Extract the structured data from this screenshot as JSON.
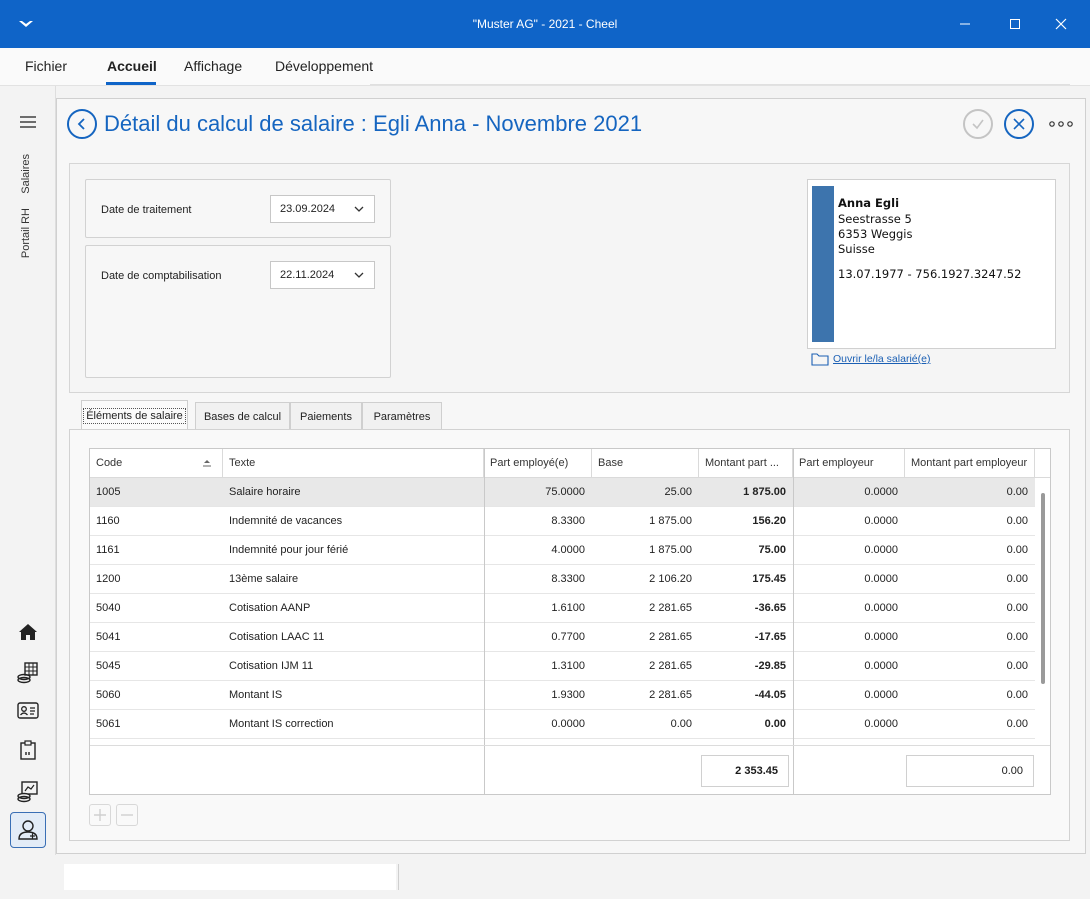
{
  "window": {
    "title": "\"Muster AG\" - 2021 - Cheel"
  },
  "menu": {
    "items": [
      "Fichier",
      "Accueil",
      "Affichage",
      "Développement"
    ],
    "active": "Accueil"
  },
  "rail": {
    "vertical_labels": [
      "Salaires",
      "Portail RH"
    ],
    "icons": [
      "menu-icon",
      "home-icon",
      "payroll-icon",
      "employee-card-icon",
      "calendar-icon",
      "accounting-icon",
      "person-icon",
      "settings-sliders-icon"
    ]
  },
  "page": {
    "title": "Détail du calcul de salaire : Egli Anna - Novembre 2021"
  },
  "dates": {
    "processing_label": "Date de traitement",
    "processing_value": "23.09.2024",
    "booking_label": "Date de comptabilisation",
    "booking_value": "22.11.2024"
  },
  "employee": {
    "name": "Anna Egli",
    "street": "Seestrasse 5",
    "city": "6353 Weggis",
    "country": "Suisse",
    "birth_ahv": "13.07.1977 - 756.1927.3247.52",
    "open_link": "Ouvrir le/la salarié(e)",
    "accent_color": "#3d74ad"
  },
  "tabs": [
    "Éléments de salaire",
    "Bases de calcul",
    "Paiements",
    "Paramètres"
  ],
  "grid": {
    "columns": [
      "Code",
      "Texte",
      "Part employé(e)",
      "Base",
      "Montant part ...",
      "Part employeur",
      "Montant part employeur"
    ],
    "rows": [
      {
        "code": "1005",
        "text": "Salaire horaire",
        "part_emp": "75.0000",
        "base": "25.00",
        "amount": "1 875.00",
        "part_er": "0.0000",
        "amount_er": "0.00"
      },
      {
        "code": "1160",
        "text": "Indemnité de vacances",
        "part_emp": "8.3300",
        "base": "1 875.00",
        "amount": "156.20",
        "part_er": "0.0000",
        "amount_er": "0.00"
      },
      {
        "code": "1161",
        "text": "Indemnité pour jour férié",
        "part_emp": "4.0000",
        "base": "1 875.00",
        "amount": "75.00",
        "part_er": "0.0000",
        "amount_er": "0.00"
      },
      {
        "code": "1200",
        "text": "13ème salaire",
        "part_emp": "8.3300",
        "base": "2 106.20",
        "amount": "175.45",
        "part_er": "0.0000",
        "amount_er": "0.00"
      },
      {
        "code": "5040",
        "text": "Cotisation AANP",
        "part_emp": "1.6100",
        "base": "2 281.65",
        "amount": "-36.65",
        "part_er": "0.0000",
        "amount_er": "0.00"
      },
      {
        "code": "5041",
        "text": "Cotisation LAAC 11",
        "part_emp": "0.7700",
        "base": "2 281.65",
        "amount": "-17.65",
        "part_er": "0.0000",
        "amount_er": "0.00"
      },
      {
        "code": "5045",
        "text": "Cotisation IJM 11",
        "part_emp": "1.3100",
        "base": "2 281.65",
        "amount": "-29.85",
        "part_er": "0.0000",
        "amount_er": "0.00"
      },
      {
        "code": "5060",
        "text": "Montant IS",
        "part_emp": "1.9300",
        "base": "2 281.65",
        "amount": "-44.05",
        "part_er": "0.0000",
        "amount_er": "0.00"
      },
      {
        "code": "5061",
        "text": "Montant IS correction",
        "part_emp": "0.0000",
        "base": "0.00",
        "amount": "0.00",
        "part_er": "0.0000",
        "amount_er": "0.00"
      }
    ],
    "total_employee": "2 353.45",
    "total_employer": "0.00"
  }
}
